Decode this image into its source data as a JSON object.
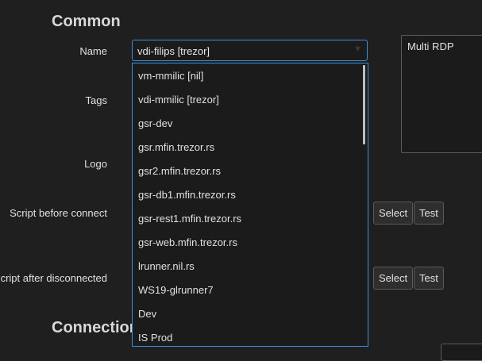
{
  "sections": {
    "common": "Common",
    "connection": "Connection"
  },
  "fields": {
    "name_label": "Name",
    "tags_label": "Tags",
    "logo_label": "Logo",
    "script_before_label": "Script before connect",
    "script_after_label": "Script after disconnected"
  },
  "name_combo": {
    "selected": "vdi-filips [trezor]",
    "options": [
      "vm-mmilic [nil]",
      "vdi-mmilic [trezor]",
      "gsr-dev",
      "gsr.mfin.trezor.rs",
      "gsr2.mfin.trezor.rs",
      "gsr-db1.mfin.trezor.rs",
      "gsr-rest1.mfin.trezor.rs",
      "gsr-web.mfin.trezor.rs",
      "lrunner.nil.rs",
      "WS19-glrunner7",
      "Dev",
      "IS Prod"
    ]
  },
  "notes_box": {
    "text": "Multi RDP"
  },
  "buttons": {
    "select_before": "Select",
    "test_before": "Test",
    "select_after": "Select",
    "test_after": "Test"
  },
  "icons": {
    "combo_chevron": "chevron-down-icon"
  }
}
